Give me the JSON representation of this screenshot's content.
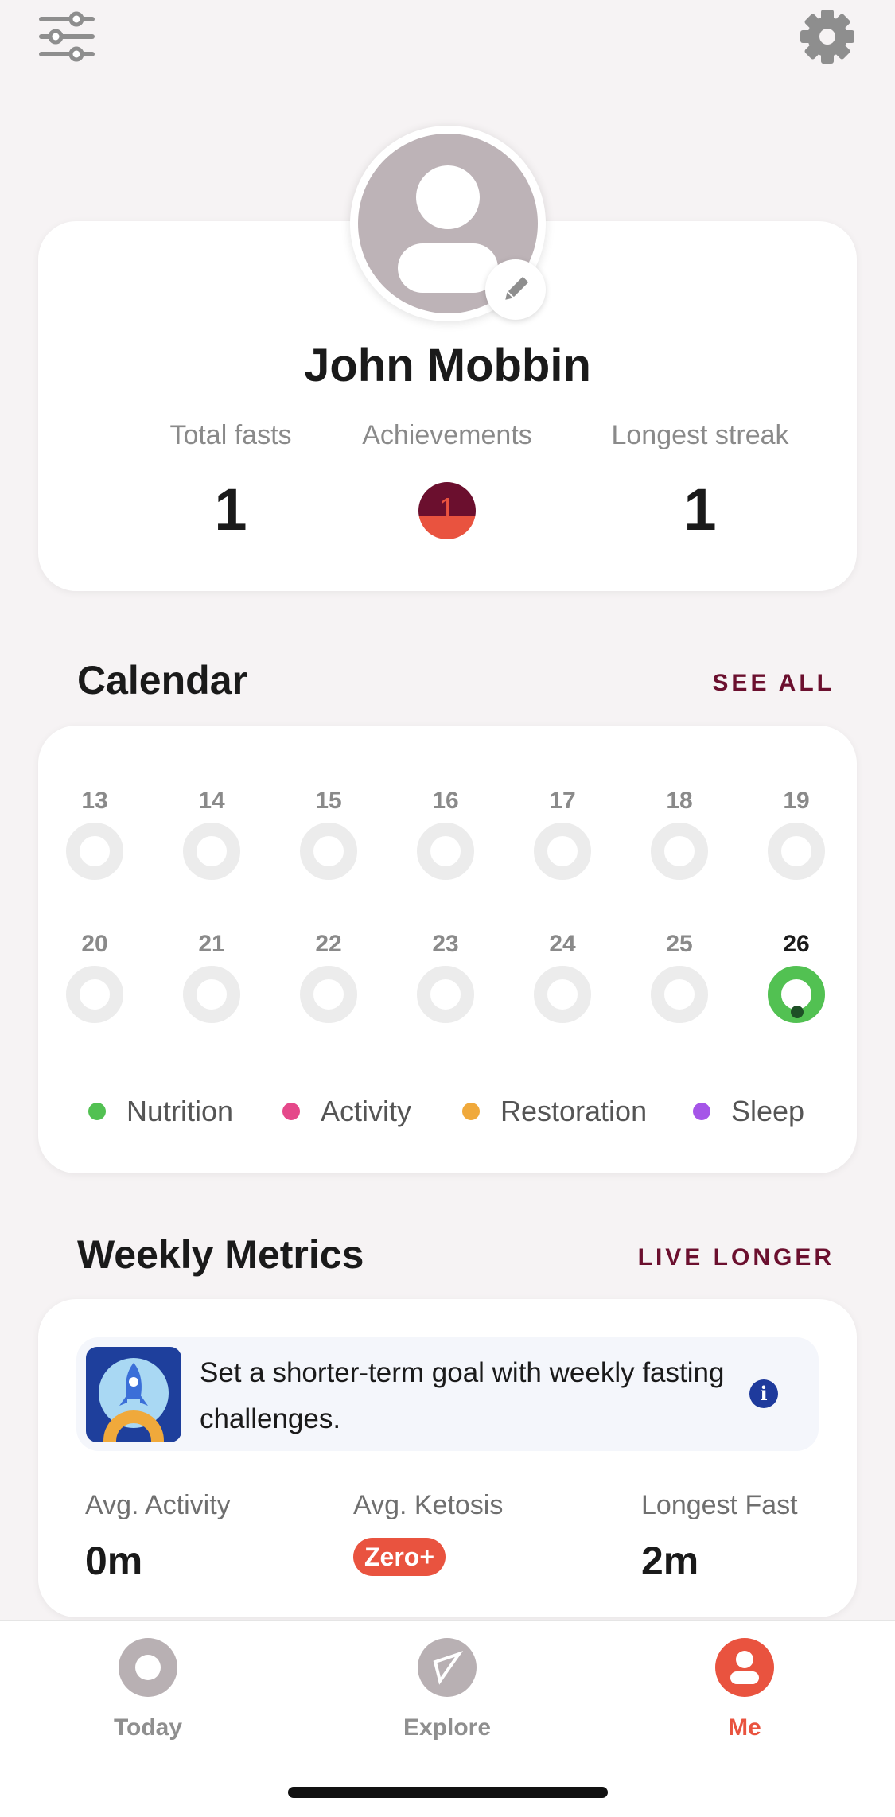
{
  "profile": {
    "name": "John Mobbin",
    "stats": [
      {
        "label": "Total fasts",
        "value": "1"
      },
      {
        "label": "Achievements",
        "value": "1"
      },
      {
        "label": "Longest streak",
        "value": "1"
      }
    ]
  },
  "calendar": {
    "title": "Calendar",
    "link": "SEE ALL",
    "week1": [
      "13",
      "14",
      "15",
      "16",
      "17",
      "18",
      "19"
    ],
    "week2": [
      "20",
      "21",
      "22",
      "23",
      "24",
      "25",
      "26"
    ],
    "today": "26",
    "legend": [
      {
        "label": "Nutrition",
        "color": "#52c152"
      },
      {
        "label": "Activity",
        "color": "#e5488a"
      },
      {
        "label": "Restoration",
        "color": "#f0a93b"
      },
      {
        "label": "Sleep",
        "color": "#a555e8"
      }
    ]
  },
  "metrics": {
    "title": "Weekly Metrics",
    "link": "LIVE LONGER",
    "promo_text": "Set a shorter-term goal with weekly fasting challenges.",
    "items": [
      {
        "label": "Avg. Activity",
        "value": "0m"
      },
      {
        "label": "Avg. Ketosis",
        "value": "Zero+"
      },
      {
        "label": "Longest Fast",
        "value": "2m"
      }
    ]
  },
  "tabs": [
    {
      "label": "Today",
      "icon": "today-icon"
    },
    {
      "label": "Explore",
      "icon": "compass-icon"
    },
    {
      "label": "Me",
      "icon": "person-icon"
    }
  ],
  "colors": {
    "accent": "#e9533f",
    "brand": "#6b0f2e",
    "ring_inactive": "#ececec",
    "ring_active": "#52c152"
  }
}
